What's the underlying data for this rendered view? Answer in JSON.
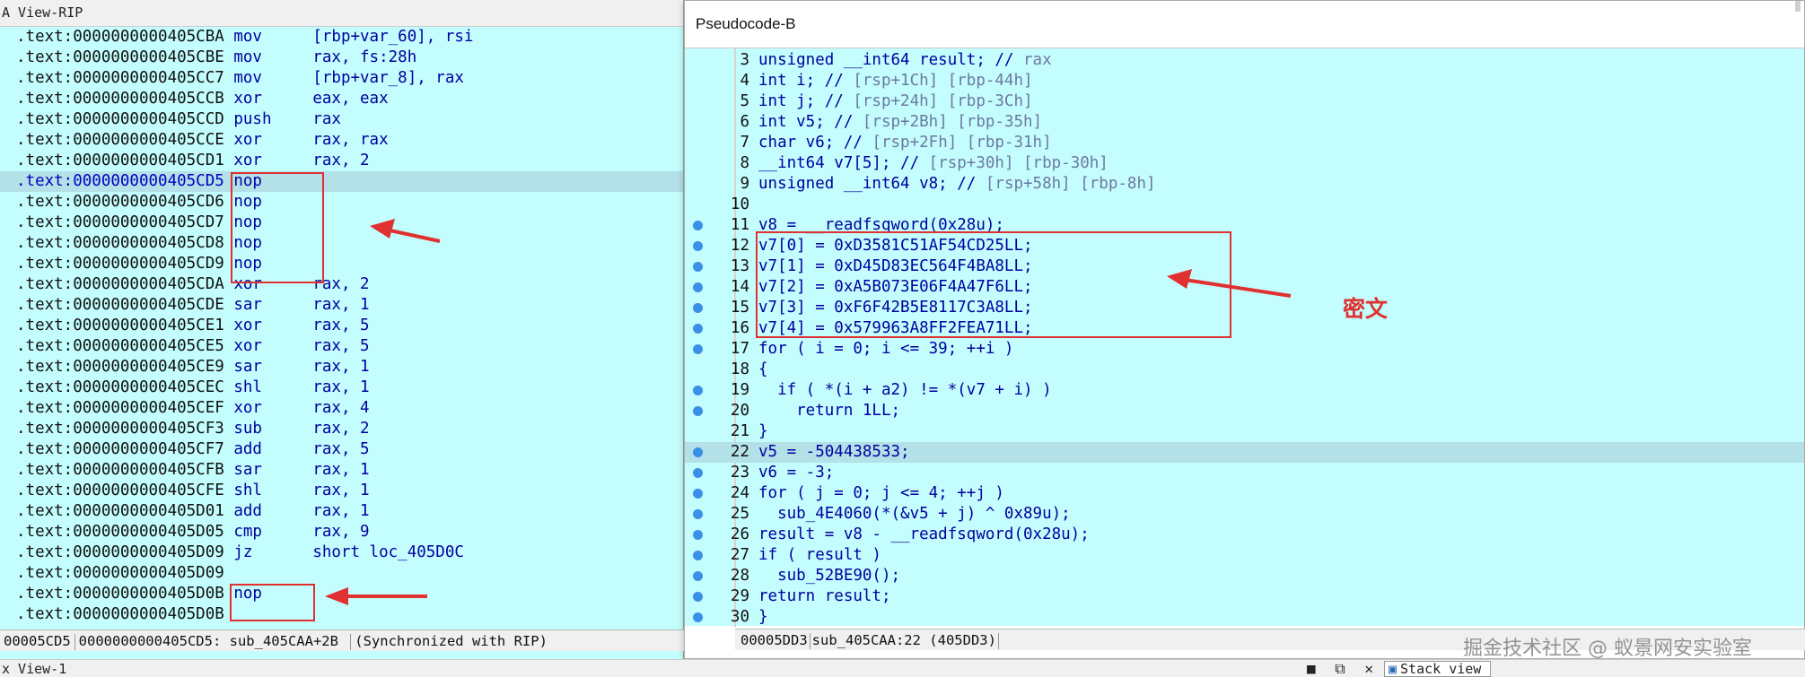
{
  "ida_view": {
    "title": "A View-RIP",
    "lines": [
      {
        "addr": ".text:0000000000405CBA",
        "mn": "mov",
        "op": "[rbp+var_60], rsi"
      },
      {
        "addr": ".text:0000000000405CBE",
        "mn": "mov",
        "op": "rax, fs:28h"
      },
      {
        "addr": ".text:0000000000405CC7",
        "mn": "mov",
        "op": "[rbp+var_8], rax"
      },
      {
        "addr": ".text:0000000000405CCB",
        "mn": "xor",
        "op": "eax, eax"
      },
      {
        "addr": ".text:0000000000405CCD",
        "mn": "push",
        "op": "rax"
      },
      {
        "addr": ".text:0000000000405CCE",
        "mn": "xor",
        "op": "rax, rax"
      },
      {
        "addr": ".text:0000000000405CD1",
        "mn": "xor",
        "op": "rax, 2"
      },
      {
        "addr": ".text:0000000000405CD5",
        "mn": "nop",
        "op": ""
      },
      {
        "addr": ".text:0000000000405CD6",
        "mn": "nop",
        "op": ""
      },
      {
        "addr": ".text:0000000000405CD7",
        "mn": "nop",
        "op": ""
      },
      {
        "addr": ".text:0000000000405CD8",
        "mn": "nop",
        "op": ""
      },
      {
        "addr": ".text:0000000000405CD9",
        "mn": "nop",
        "op": ""
      },
      {
        "addr": ".text:0000000000405CDA",
        "mn": "xor",
        "op": "rax, 2"
      },
      {
        "addr": ".text:0000000000405CDE",
        "mn": "sar",
        "op": "rax, 1"
      },
      {
        "addr": ".text:0000000000405CE1",
        "mn": "xor",
        "op": "rax, 5"
      },
      {
        "addr": ".text:0000000000405CE5",
        "mn": "xor",
        "op": "rax, 5"
      },
      {
        "addr": ".text:0000000000405CE9",
        "mn": "sar",
        "op": "rax, 1"
      },
      {
        "addr": ".text:0000000000405CEC",
        "mn": "shl",
        "op": "rax, 1"
      },
      {
        "addr": ".text:0000000000405CEF",
        "mn": "xor",
        "op": "rax, 4"
      },
      {
        "addr": ".text:0000000000405CF3",
        "mn": "sub",
        "op": "rax, 2"
      },
      {
        "addr": ".text:0000000000405CF7",
        "mn": "add",
        "op": "rax, 5"
      },
      {
        "addr": ".text:0000000000405CFB",
        "mn": "sar",
        "op": "rax, 1"
      },
      {
        "addr": ".text:0000000000405CFE",
        "mn": "shl",
        "op": "rax, 1"
      },
      {
        "addr": ".text:0000000000405D01",
        "mn": "add",
        "op": "rax, 1"
      },
      {
        "addr": ".text:0000000000405D05",
        "mn": "cmp",
        "op": "rax, 9"
      },
      {
        "addr": ".text:0000000000405D09",
        "mn": "jz",
        "op": "short loc_405D0C"
      },
      {
        "addr": ".text:0000000000405D09",
        "mn": "",
        "op": ""
      },
      {
        "addr": ".text:0000000000405D0B",
        "mn": "nop",
        "op": ""
      },
      {
        "addr": ".text:0000000000405D0B",
        "mn": "",
        "op": ""
      }
    ],
    "highlighted_index": 7,
    "status": {
      "offset": "00005CD5",
      "location": "0000000000405CD5: sub_405CAA+2B",
      "sync": "(Synchronized with RIP)"
    }
  },
  "pseudocode": {
    "title": "Pseudocode-B",
    "lines": [
      {
        "n": "3",
        "dot": false,
        "code": "unsigned __int64 result; // ",
        "cmt": "rax"
      },
      {
        "n": "4",
        "dot": false,
        "code": "int i; // ",
        "cmt": "[rsp+1Ch] [rbp-44h]"
      },
      {
        "n": "5",
        "dot": false,
        "code": "int j; // ",
        "cmt": "[rsp+24h] [rbp-3Ch]"
      },
      {
        "n": "6",
        "dot": false,
        "code": "int v5; // ",
        "cmt": "[rsp+2Bh] [rbp-35h]"
      },
      {
        "n": "7",
        "dot": false,
        "code": "char v6; // ",
        "cmt": "[rsp+2Fh] [rbp-31h]"
      },
      {
        "n": "8",
        "dot": false,
        "code": "__int64 v7[5]; // ",
        "cmt": "[rsp+30h] [rbp-30h]"
      },
      {
        "n": "9",
        "dot": false,
        "code": "unsigned __int64 v8; // ",
        "cmt": "[rsp+58h] [rbp-8h]"
      },
      {
        "n": "10",
        "dot": false,
        "code": "",
        "cmt": ""
      },
      {
        "n": "11",
        "dot": true,
        "code": "v8 = __readfsqword(0x28u);",
        "cmt": ""
      },
      {
        "n": "12",
        "dot": true,
        "code": "v7[0] = 0xD3581C51AF54CD25LL;",
        "cmt": ""
      },
      {
        "n": "13",
        "dot": true,
        "code": "v7[1] = 0xD45D83EC564F4BA8LL;",
        "cmt": ""
      },
      {
        "n": "14",
        "dot": true,
        "code": "v7[2] = 0xA5B073E06F4A47F6LL;",
        "cmt": ""
      },
      {
        "n": "15",
        "dot": true,
        "code": "v7[3] = 0xF6F42B5E8117C3A8LL;",
        "cmt": ""
      },
      {
        "n": "16",
        "dot": true,
        "code": "v7[4] = 0x579963A8FF2FEA71LL;",
        "cmt": ""
      },
      {
        "n": "17",
        "dot": true,
        "code": "for ( i = 0; i <= 39; ++i )",
        "cmt": ""
      },
      {
        "n": "18",
        "dot": false,
        "code": "{",
        "cmt": ""
      },
      {
        "n": "19",
        "dot": true,
        "code": "  if ( *(i + a2) != *(v7 + i) )",
        "cmt": ""
      },
      {
        "n": "20",
        "dot": true,
        "code": "    return 1LL;",
        "cmt": ""
      },
      {
        "n": "21",
        "dot": false,
        "code": "}",
        "cmt": ""
      },
      {
        "n": "22",
        "dot": true,
        "code": "v5 = -504438533;",
        "cmt": ""
      },
      {
        "n": "23",
        "dot": true,
        "code": "v6 = -3;",
        "cmt": ""
      },
      {
        "n": "24",
        "dot": true,
        "code": "for ( j = 0; j <= 4; ++j )",
        "cmt": ""
      },
      {
        "n": "25",
        "dot": true,
        "code": "  sub_4E4060(*(&v5 + j) ^ 0x89u);",
        "cmt": ""
      },
      {
        "n": "26",
        "dot": true,
        "code": "result = v8 - __readfsqword(0x28u);",
        "cmt": ""
      },
      {
        "n": "27",
        "dot": true,
        "code": "if ( result )",
        "cmt": ""
      },
      {
        "n": "28",
        "dot": true,
        "code": "  sub_52BE90();",
        "cmt": ""
      },
      {
        "n": "29",
        "dot": true,
        "code": "return result;",
        "cmt": ""
      },
      {
        "n": "30",
        "dot": true,
        "code": "}",
        "cmt": ""
      }
    ],
    "highlighted_line": "22",
    "status": {
      "offset": "00005DD3",
      "location": "sub_405CAA:22 (405DD3)"
    }
  },
  "annotation_label": "密文",
  "bottom": {
    "hex_view_title": "x View-1",
    "stack_view_tab": "Stack view"
  },
  "watermark": "掘金技术社区 @ 蚁景网安实验室",
  "colors": {
    "annotation_red": "#e03030",
    "ida_background": "#c4fdfd",
    "highlight_row": "#b4e0e8",
    "keyword_blue": "#0000a0"
  }
}
